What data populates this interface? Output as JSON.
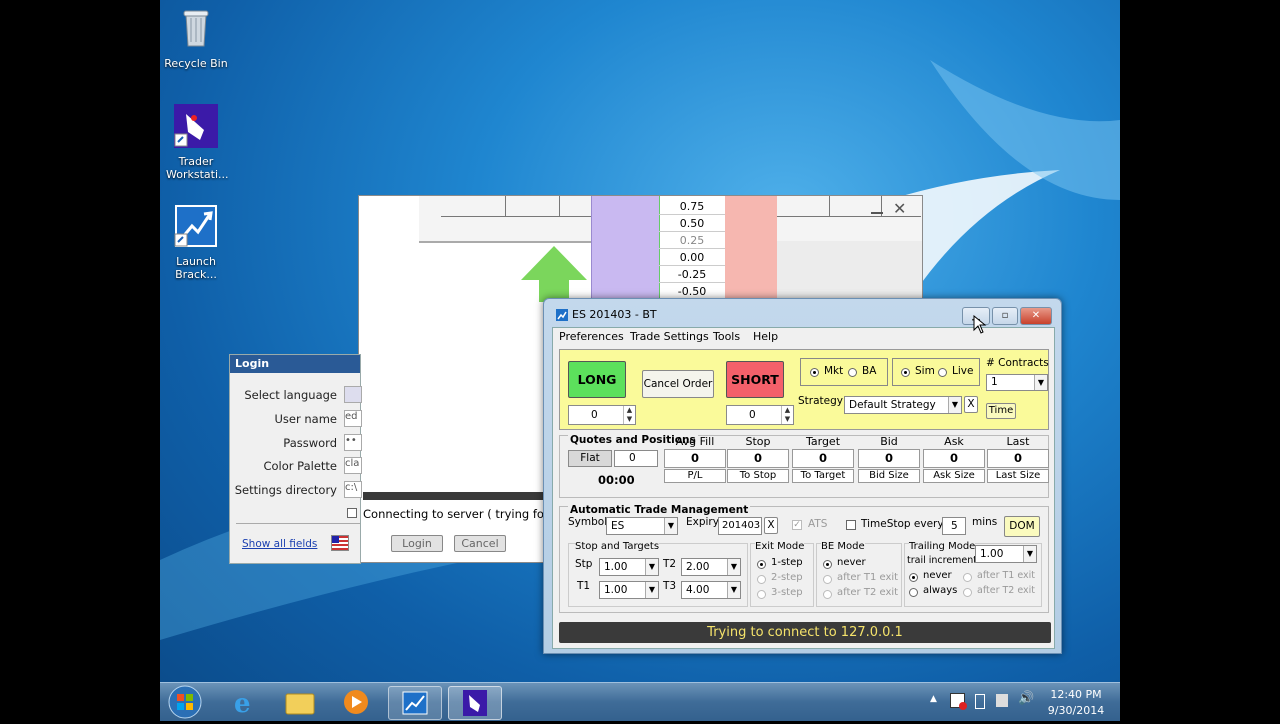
{
  "desktop_icons": [
    {
      "label": "Recycle Bin",
      "icon": "recycle-bin-icon"
    },
    {
      "label": "Trader Workstati...",
      "icon": "trader-workstation-icon"
    },
    {
      "label": "Launch Brack...",
      "icon": "launch-bracket-icon"
    }
  ],
  "dom_ladder": {
    "values": [
      "0.75",
      "0.50",
      "0.25",
      "0.00",
      "-0.25",
      "-0.50"
    ]
  },
  "login": {
    "title": "Login",
    "fields": [
      {
        "label": "Select language",
        "value": ""
      },
      {
        "label": "User name",
        "value": "ed"
      },
      {
        "label": "Password",
        "value": "••"
      },
      {
        "label": "Color Palette",
        "value": "cla"
      },
      {
        "label": "Settings directory",
        "value": "c:\\"
      }
    ],
    "show_all_fields": "Show all fields",
    "status": "Connecting to server ( trying for ano",
    "login_button": "Login",
    "cancel_button": "Cancel"
  },
  "window": {
    "title": "ES 201403 - BT",
    "menu": [
      "Preferences",
      "Trade Settings",
      "Tools",
      "Help"
    ],
    "long_label": "LONG",
    "short_label": "SHORT",
    "cancel_order": "Cancel Order",
    "long_qty": "0",
    "short_qty": "0",
    "order_type": {
      "mkt": "Mkt",
      "ba": "BA"
    },
    "mode": {
      "sim": "Sim",
      "live": "Live"
    },
    "contracts_label": "# Contracts",
    "contracts_value": "1",
    "strategy_label": "Strategy",
    "strategy_value": "Default Strategy",
    "strategy_clear": "X",
    "time_button": "Time",
    "quotes": {
      "title": "Quotes and Positions",
      "position_label": "Flat",
      "position_value": "0",
      "timer": "00:00",
      "columns": [
        {
          "head": "Avg Fill",
          "value": "0",
          "sub": "P/L"
        },
        {
          "head": "Stop",
          "value": "0",
          "sub": "To Stop"
        },
        {
          "head": "Target",
          "value": "0",
          "sub": "To Target"
        },
        {
          "head": "Bid",
          "value": "0",
          "sub": "Bid Size"
        },
        {
          "head": "Ask",
          "value": "0",
          "sub": "Ask Size"
        },
        {
          "head": "Last",
          "value": "0",
          "sub": "Last Size"
        }
      ]
    },
    "atm": {
      "title": "Automatic Trade Management",
      "symbol_label": "Symbol",
      "symbol_value": "ES",
      "expiry_label": "Expiry",
      "expiry_value": "201403",
      "expiry_clear": "X",
      "ats_label": "ATS",
      "timestop_label": "TimeStop every",
      "timestop_value": "5",
      "mins_label": "mins",
      "dom_button": "DOM",
      "stops_title": "Stop and Targets",
      "stp_label": "Stp",
      "stp_value": "1.00",
      "t1_label": "T1",
      "t1_value": "1.00",
      "t2_label": "T2",
      "t2_value": "2.00",
      "t3_label": "T3",
      "t3_value": "4.00",
      "exit_title": "Exit Mode",
      "exit_options": [
        "1-step",
        "2-step",
        "3-step"
      ],
      "be_title": "BE Mode",
      "be_options": [
        "never",
        "after T1 exit",
        "after T2 exit"
      ],
      "trailing_title": "Trailing Mode",
      "trail_increment_label": "trail increment",
      "trail_increment_value": "1.00",
      "trail_options": [
        "never",
        "after T1 exit",
        "always",
        "after T2 exit"
      ]
    },
    "status": "Trying to connect to 127.0.0.1"
  },
  "taskbar": {
    "time": "12:40 PM",
    "date": "9/30/2014"
  }
}
